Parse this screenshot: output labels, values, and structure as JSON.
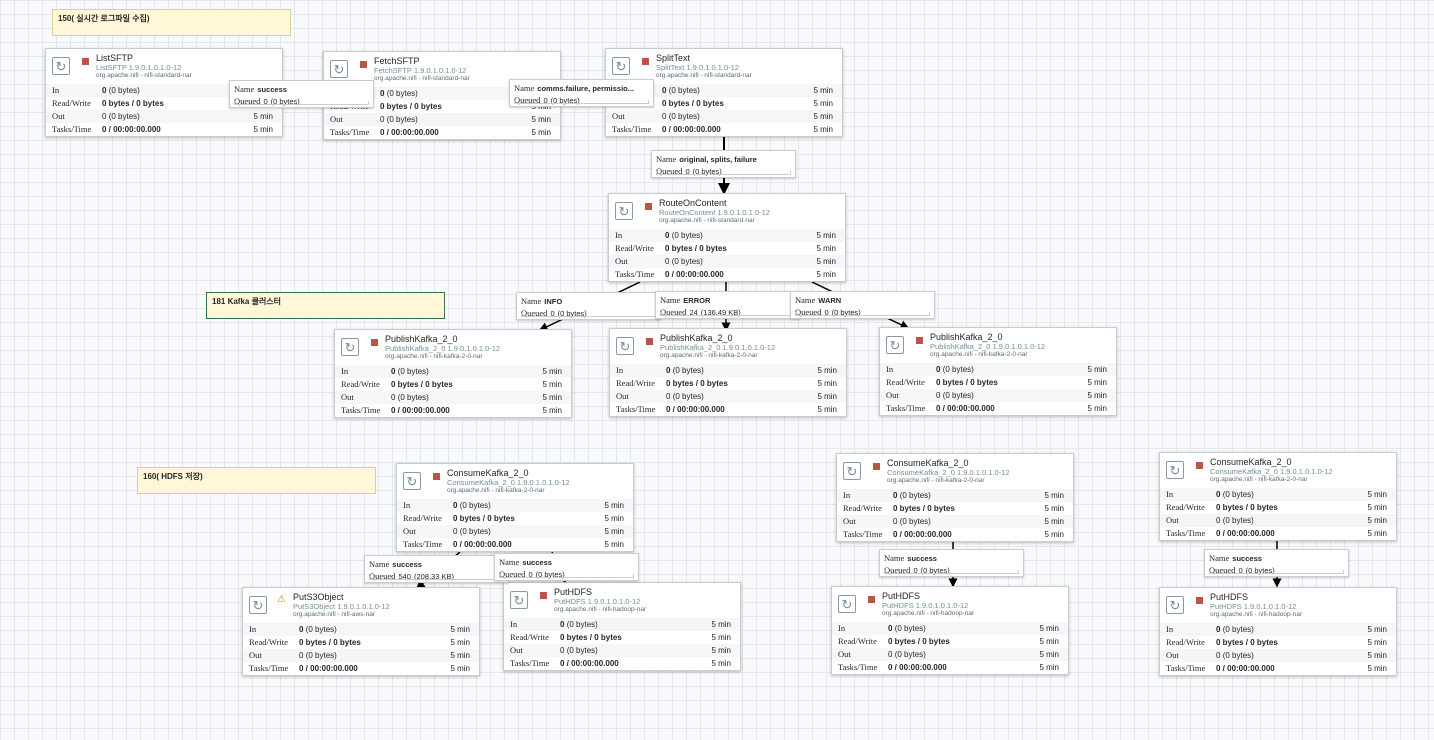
{
  "labels": {
    "group150": "150( 실시간 로그파일 수집)",
    "group181": "181 Kafka 클러스터",
    "group160": "160( HDFS 저장)"
  },
  "field_names": {
    "in": "In",
    "rw": "Read/Write",
    "out": "Out",
    "tasks": "Tasks/Time",
    "conn_name": "Name",
    "conn_queued": "Queued"
  },
  "processors": {
    "listsftp": {
      "name": "ListSFTP",
      "version": "ListSFTP 1.9.0.1.0.1.0-12",
      "bundle": "org.apache.nifi - nifi-standard-nar",
      "in": "0",
      "in_size": "(0 bytes)",
      "rw": "0 bytes / 0 bytes",
      "out": "0",
      "out_size": "(0 bytes)",
      "tasks": "0 / 00:00:00.000",
      "time": "5 min"
    },
    "fetchsftp": {
      "name": "FetchSFTP",
      "version": "FetchSFTP 1.9.0.1.0.1.0-12",
      "bundle": "org.apache.nifi - nifi-standard-nar",
      "in": "0",
      "in_size": "(0 bytes)",
      "rw": "0 bytes / 0 bytes",
      "out": "0",
      "out_size": "(0 bytes)",
      "tasks": "0 / 00:00:00.000",
      "time": "5 min"
    },
    "splittext": {
      "name": "SplitText",
      "version": "SplitText 1.9.0.1.0.1.0-12",
      "bundle": "org.apache.nifi - nifi-standard-nar",
      "in": "0",
      "in_size": "(0 bytes)",
      "rw": "0 bytes / 0 bytes",
      "out": "0",
      "out_size": "(0 bytes)",
      "tasks": "0 / 00:00:00.000",
      "time": "5 min"
    },
    "routeoncontent": {
      "name": "RouteOnContent",
      "version": "RouteOnContent 1.9.0.1.0.1.0-12",
      "bundle": "org.apache.nifi - nifi-standard-nar",
      "in": "0",
      "in_size": "(0 bytes)",
      "rw": "0 bytes / 0 bytes",
      "out": "0",
      "out_size": "(0 bytes)",
      "tasks": "0 / 00:00:00.000",
      "time": "5 min"
    },
    "publish1": {
      "name": "PublishKafka_2_0",
      "version": "PublishKafka_2_0 1.9.0.1.0.1.0-12",
      "bundle": "org.apache.nifi - nifi-kafka-2-0-nar",
      "in": "0",
      "in_size": "(0 bytes)",
      "rw": "0 bytes / 0 bytes",
      "out": "0",
      "out_size": "(0 bytes)",
      "tasks": "0 / 00:00:00.000",
      "time": "5 min"
    },
    "publish2": {
      "name": "PublishKafka_2_0",
      "version": "PublishKafka_2_0 1.9.0.1.0.1.0-12",
      "bundle": "org.apache.nifi - nifi-kafka-2-0-nar",
      "in": "0",
      "in_size": "(0 bytes)",
      "rw": "0 bytes / 0 bytes",
      "out": "0",
      "out_size": "(0 bytes)",
      "tasks": "0 / 00:00:00.000",
      "time": "5 min"
    },
    "publish3": {
      "name": "PublishKafka_2_0",
      "version": "PublishKafka_2_0 1.9.0.1.0.1.0-12",
      "bundle": "org.apache.nifi - nifi-kafka-2-0-nar",
      "in": "0",
      "in_size": "(0 bytes)",
      "rw": "0 bytes / 0 bytes",
      "out": "0",
      "out_size": "(0 bytes)",
      "tasks": "0 / 00:00:00.000",
      "time": "5 min"
    },
    "consume1": {
      "name": "ConsumeKafka_2_0",
      "version": "ConsumeKafka_2_0 1.9.0.1.0.1.0-12",
      "bundle": "org.apache.nifi - nifi-kafka-2-0-nar",
      "in": "0",
      "in_size": "(0 bytes)",
      "rw": "0 bytes / 0 bytes",
      "out": "0",
      "out_size": "(0 bytes)",
      "tasks": "0 / 00:00:00.000",
      "time": "5 min"
    },
    "consume2": {
      "name": "ConsumeKafka_2_0",
      "version": "ConsumeKafka_2_0 1.9.0.1.0.1.0-12",
      "bundle": "org.apache.nifi - nifi-kafka-2-0-nar",
      "in": "0",
      "in_size": "(0 bytes)",
      "rw": "0 bytes / 0 bytes",
      "out": "0",
      "out_size": "(0 bytes)",
      "tasks": "0 / 00:00:00.000",
      "time": "5 min"
    },
    "consume3": {
      "name": "ConsumeKafka_2_0",
      "version": "ConsumeKafka_2_0 1.9.0.1.0.1.0-12",
      "bundle": "org.apache.nifi - nifi-kafka-2-0-nar",
      "in": "0",
      "in_size": "(0 bytes)",
      "rw": "0 bytes / 0 bytes",
      "out": "0",
      "out_size": "(0 bytes)",
      "tasks": "0 / 00:00:00.000",
      "time": "5 min"
    },
    "puts3": {
      "name": "PutS3Object",
      "version": "PutS3Object 1.9.0.1.0.1.0-12",
      "bundle": "org.apache.nifi - nifi-aws-nar",
      "in": "0",
      "in_size": "(0 bytes)",
      "rw": "0 bytes / 0 bytes",
      "out": "0",
      "out_size": "(0 bytes)",
      "tasks": "0 / 00:00:00.000",
      "time": "5 min"
    },
    "puthdfs1": {
      "name": "PutHDFS",
      "version": "PutHDFS 1.9.0.1.0.1.0-12",
      "bundle": "org.apache.nifi - nifi-hadoop-nar",
      "in": "0",
      "in_size": "(0 bytes)",
      "rw": "0 bytes / 0 bytes",
      "out": "0",
      "out_size": "(0 bytes)",
      "tasks": "0 / 00:00:00.000",
      "time": "5 min"
    },
    "puthdfs2": {
      "name": "PutHDFS",
      "version": "PutHDFS 1.9.0.1.0.1.0-12",
      "bundle": "org.apache.nifi - nifi-hadoop-nar",
      "in": "0",
      "in_size": "(0 bytes)",
      "rw": "0 bytes / 0 bytes",
      "out": "0",
      "out_size": "(0 bytes)",
      "tasks": "0 / 00:00:00.000",
      "time": "5 min"
    },
    "puthdfs3": {
      "name": "PutHDFS",
      "version": "PutHDFS 1.9.0.1.0.1.0-12",
      "bundle": "org.apache.nifi - nifi-hadoop-nar",
      "in": "0",
      "in_size": "(0 bytes)",
      "rw": "0 bytes / 0 bytes",
      "out": "0",
      "out_size": "(0 bytes)",
      "tasks": "0 / 00:00:00.000",
      "time": "5 min"
    }
  },
  "connections": {
    "list_fetch": {
      "name": "success",
      "queued": "0",
      "queued_size": "(0 bytes)"
    },
    "fetch_split": {
      "name": "comms.failure, permissio...",
      "queued": "0",
      "queued_size": "(0 bytes)"
    },
    "split_route": {
      "name": "original, splits, failure",
      "queued": "0",
      "queued_size": "(0 bytes)"
    },
    "route_info": {
      "name": "INFO",
      "queued": "0",
      "queued_size": "(0 bytes)"
    },
    "route_error": {
      "name": "ERROR",
      "queued": "24",
      "queued_size": "(136.49 KB)"
    },
    "route_warn": {
      "name": "WARN",
      "queued": "0",
      "queued_size": "(0 bytes)"
    },
    "consume_s3": {
      "name": "success",
      "queued": "540",
      "queued_size": "(208.33 KB)"
    },
    "consume_hdfs1": {
      "name": "success",
      "queued": "0",
      "queued_size": "(0 bytes)"
    },
    "consume_hdfs2": {
      "name": "success",
      "queued": "0",
      "queued_size": "(0 bytes)"
    },
    "consume_hdfs3": {
      "name": "success",
      "queued": "0",
      "queued_size": "(0 bytes)"
    }
  },
  "colors": {
    "stopped": "#ba554a",
    "warning": "#c8931c",
    "canvas_grid": "#e3e8eb",
    "label_bg": "#fff7d7"
  },
  "icons": {
    "processor": "refresh-icon",
    "stopped": "stop-icon",
    "invalid": "warning-icon"
  }
}
